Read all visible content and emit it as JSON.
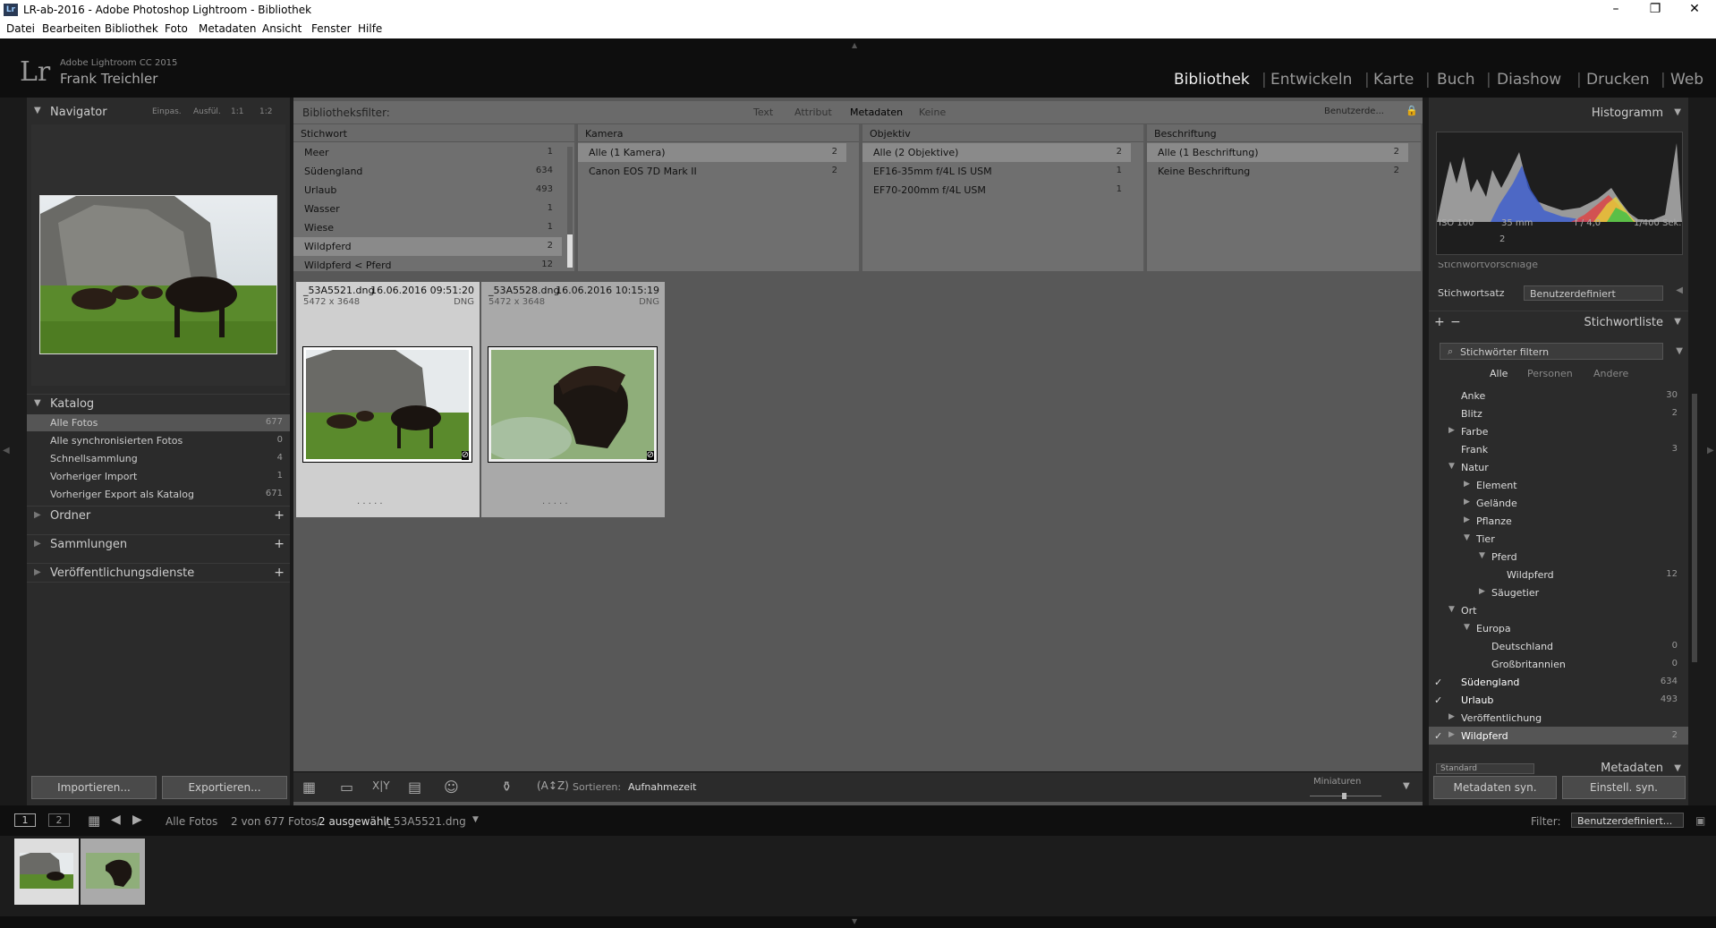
{
  "window": {
    "title": "LR-ab-2016 - Adobe Photoshop Lightroom - Bibliothek",
    "app_icon": "Lr"
  },
  "menu": [
    "Datei",
    "Bearbeiten",
    "Bibliothek",
    "Foto",
    "Metadaten",
    "Ansicht",
    "Fenster",
    "Hilfe"
  ],
  "identity": {
    "product": "Adobe Lightroom CC 2015",
    "user": "Frank Treichler",
    "logo": "Lr"
  },
  "modules": [
    "Bibliothek",
    "Entwickeln",
    "Karte",
    "Buch",
    "Diashow",
    "Drucken",
    "Web"
  ],
  "navigator": {
    "title": "Navigator",
    "zoom": [
      "Einpas.",
      "Ausfül.",
      "1:1",
      "1:2"
    ]
  },
  "catalog": {
    "title": "Katalog",
    "items": [
      {
        "label": "Alle Fotos",
        "count": "677"
      },
      {
        "label": "Alle synchronisierten Fotos",
        "count": "0"
      },
      {
        "label": "Schnellsammlung",
        "count": "4"
      },
      {
        "label": "Vorheriger Import",
        "count": "1"
      },
      {
        "label": "Vorheriger Export als Katalog",
        "count": "671"
      }
    ]
  },
  "left_sections": [
    "Ordner",
    "Sammlungen",
    "Veröffentlichungsdienste"
  ],
  "left_buttons": {
    "import": "Importieren...",
    "export": "Exportieren..."
  },
  "filter": {
    "label": "Bibliotheksfilter:",
    "tabs": [
      "Text",
      "Attribut",
      "Metadaten",
      "Keine"
    ],
    "preset": "Benutzerde...",
    "columns": [
      {
        "header": "Stichwort",
        "rows": [
          [
            "Meer",
            "1"
          ],
          [
            "Südengland",
            "634"
          ],
          [
            "Urlaub",
            "493"
          ],
          [
            "Wasser",
            "1"
          ],
          [
            "Wiese",
            "1"
          ],
          [
            "Wildpferd",
            "2"
          ],
          [
            "Wildpferd < Pferd",
            "12"
          ]
        ]
      },
      {
        "header": "Kamera",
        "rows": [
          [
            "Alle (1 Kamera)",
            "2"
          ],
          [
            "Canon EOS 7D Mark II",
            "2"
          ]
        ]
      },
      {
        "header": "Objektiv",
        "rows": [
          [
            "Alle (2 Objektive)",
            "2"
          ],
          [
            "EF16-35mm f/4L IS USM",
            "1"
          ],
          [
            "EF70-200mm f/4L USM",
            "1"
          ]
        ]
      },
      {
        "header": "Beschriftung",
        "rows": [
          [
            "Alle (1 Beschriftung)",
            "2"
          ],
          [
            "Keine Beschriftung",
            "2"
          ]
        ]
      }
    ]
  },
  "grid": [
    {
      "name": "_53A5521.dng",
      "date": "16.06.2016 09:51:20",
      "dims": "5472 x 3648",
      "type": "DNG",
      "dots": "· · · · ·"
    },
    {
      "name": "_53A5528.dng",
      "date": "16.06.2016 10:15:19",
      "dims": "5472 x 3648",
      "type": "DNG",
      "dots": "· · · · ·"
    }
  ],
  "toolbar": {
    "sort_label": "Sortieren:",
    "sort_value": "Aufnahmezeit",
    "thumbs_label": "Miniaturen"
  },
  "histogram": {
    "title": "Histogramm",
    "iso": "ISO 100",
    "focal": "35 mm",
    "aperture": "f / 4,0",
    "shutter": "1/400 Sek.",
    "count": "2"
  },
  "keywording": {
    "cut_label": "Stichwortvorschläge",
    "set_label": "Stichwortsatz",
    "set_value": "Benutzerdefiniert"
  },
  "keywordlist": {
    "title": "Stichwortliste",
    "filter_placeholder": "Stichwörter filtern",
    "tabs": [
      "Alle",
      "Personen",
      "Andere"
    ],
    "items": [
      {
        "label": "Anke",
        "count": "30",
        "level": 0,
        "tri": "",
        "check": ""
      },
      {
        "label": "Blitz",
        "count": "2",
        "level": 0,
        "tri": "",
        "check": ""
      },
      {
        "label": "Farbe",
        "count": "",
        "level": 0,
        "tri": "▶",
        "check": ""
      },
      {
        "label": "Frank",
        "count": "3",
        "level": 0,
        "tri": "",
        "check": ""
      },
      {
        "label": "Natur",
        "count": "",
        "level": 0,
        "tri": "▼",
        "check": ""
      },
      {
        "label": "Element",
        "count": "",
        "level": 1,
        "tri": "▶",
        "check": ""
      },
      {
        "label": "Gelände",
        "count": "",
        "level": 1,
        "tri": "▶",
        "check": ""
      },
      {
        "label": "Pflanze",
        "count": "",
        "level": 1,
        "tri": "▶",
        "check": ""
      },
      {
        "label": "Tier",
        "count": "",
        "level": 1,
        "tri": "▼",
        "check": ""
      },
      {
        "label": "Pferd",
        "count": "",
        "level": 2,
        "tri": "▼",
        "check": ""
      },
      {
        "label": "Wildpferd",
        "count": "12",
        "level": 3,
        "tri": "",
        "check": ""
      },
      {
        "label": "Säugetier",
        "count": "",
        "level": 2,
        "tri": "▶",
        "check": ""
      },
      {
        "label": "Ort",
        "count": "",
        "level": 0,
        "tri": "▼",
        "check": ""
      },
      {
        "label": "Europa",
        "count": "",
        "level": 1,
        "tri": "▼",
        "check": ""
      },
      {
        "label": "Deutschland",
        "count": "0",
        "level": 2,
        "tri": "",
        "check": ""
      },
      {
        "label": "Großbritannien",
        "count": "0",
        "level": 2,
        "tri": "",
        "check": ""
      },
      {
        "label": "Südengland",
        "count": "634",
        "level": 0,
        "tri": "",
        "check": "✓"
      },
      {
        "label": "Urlaub",
        "count": "493",
        "level": 0,
        "tri": "",
        "check": "✓"
      },
      {
        "label": "Veröffentlichung",
        "count": "",
        "level": 0,
        "tri": "▶",
        "check": ""
      },
      {
        "label": "Wildpferd",
        "count": "2",
        "level": 0,
        "tri": "▶",
        "check": "✓"
      }
    ]
  },
  "metadata": {
    "title": "Metadaten",
    "preset": "Standard"
  },
  "right_buttons": {
    "sync_meta": "Metadaten syn.",
    "sync_settings": "Einstell. syn."
  },
  "filmstrip": {
    "page1": "1",
    "page2": "2",
    "source": "Alle Fotos",
    "count": "2 von 677 Fotos/",
    "selected": "2 ausgewählt",
    "file": "/_53A5521.dng",
    "filter_label": "Filter:",
    "filter_value": "Benutzerdefiniert..."
  }
}
